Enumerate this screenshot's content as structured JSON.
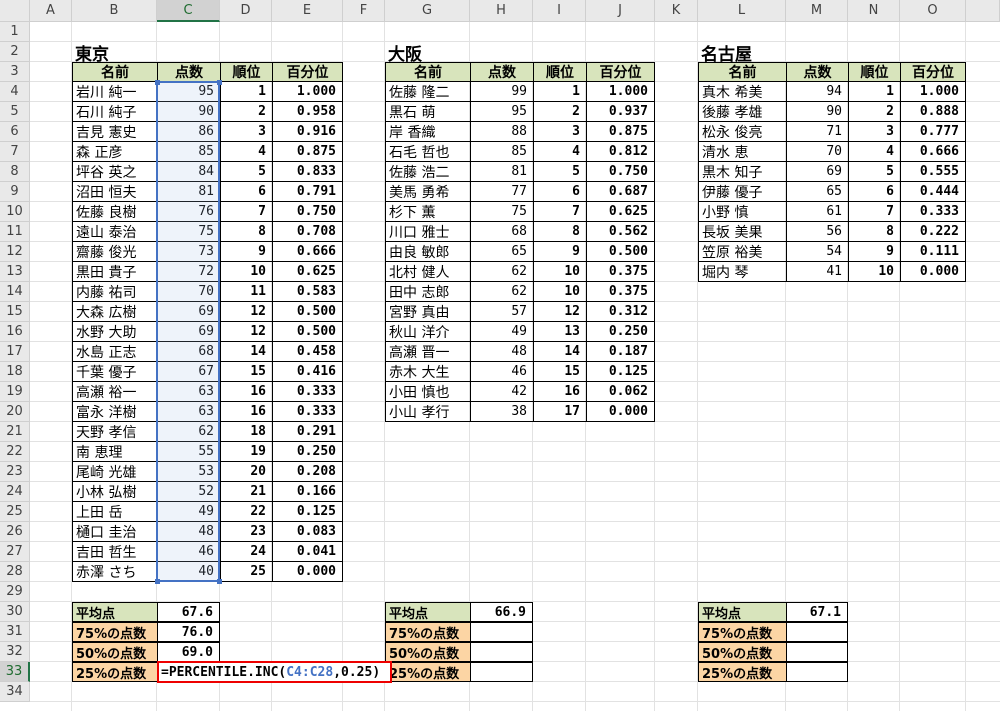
{
  "columns": [
    "A",
    "B",
    "C",
    "D",
    "E",
    "F",
    "G",
    "H",
    "I",
    "J",
    "K",
    "L",
    "M",
    "N",
    "O"
  ],
  "rows": [
    "1",
    "2",
    "3",
    "4",
    "5",
    "6",
    "7",
    "8",
    "9",
    "10",
    "11",
    "12",
    "13",
    "14",
    "15",
    "16",
    "17",
    "18",
    "19",
    "20",
    "21",
    "22",
    "23",
    "24",
    "25",
    "26",
    "27",
    "28",
    "29",
    "30",
    "31",
    "32",
    "33",
    "34"
  ],
  "active_column": "C",
  "active_row": "33",
  "tables": [
    {
      "id": "tokyo",
      "title": "東京",
      "headers": [
        "名前",
        "点数",
        "順位",
        "百分位"
      ],
      "rows": [
        [
          "岩川 純一",
          "95",
          "1",
          "1.000"
        ],
        [
          "石川 純子",
          "90",
          "2",
          "0.958"
        ],
        [
          "吉見 憲史",
          "86",
          "3",
          "0.916"
        ],
        [
          "森 正彦",
          "85",
          "4",
          "0.875"
        ],
        [
          "坪谷 英之",
          "84",
          "5",
          "0.833"
        ],
        [
          "沼田 恒夫",
          "81",
          "6",
          "0.791"
        ],
        [
          "佐藤 良樹",
          "76",
          "7",
          "0.750"
        ],
        [
          "遠山 泰治",
          "75",
          "8",
          "0.708"
        ],
        [
          "齋藤 俊光",
          "73",
          "9",
          "0.666"
        ],
        [
          "黒田 貴子",
          "72",
          "10",
          "0.625"
        ],
        [
          "内藤 祐司",
          "70",
          "11",
          "0.583"
        ],
        [
          "大森 広樹",
          "69",
          "12",
          "0.500"
        ],
        [
          "水野 大助",
          "69",
          "12",
          "0.500"
        ],
        [
          "水島 正志",
          "68",
          "14",
          "0.458"
        ],
        [
          "千葉 優子",
          "67",
          "15",
          "0.416"
        ],
        [
          "高瀬 裕一",
          "63",
          "16",
          "0.333"
        ],
        [
          "富永 洋樹",
          "63",
          "16",
          "0.333"
        ],
        [
          "天野 孝信",
          "62",
          "18",
          "0.291"
        ],
        [
          "南 恵理",
          "55",
          "19",
          "0.250"
        ],
        [
          "尾崎 光雄",
          "53",
          "20",
          "0.208"
        ],
        [
          "小林 弘樹",
          "52",
          "21",
          "0.166"
        ],
        [
          "上田 岳",
          "49",
          "22",
          "0.125"
        ],
        [
          "樋口 圭治",
          "48",
          "23",
          "0.083"
        ],
        [
          "吉田 哲生",
          "46",
          "24",
          "0.041"
        ],
        [
          "赤澤 さち",
          "40",
          "25",
          "0.000"
        ]
      ]
    },
    {
      "id": "osaka",
      "title": "大阪",
      "headers": [
        "名前",
        "点数",
        "順位",
        "百分位"
      ],
      "rows": [
        [
          "佐藤 隆二",
          "99",
          "1",
          "1.000"
        ],
        [
          "黒石 萌",
          "95",
          "2",
          "0.937"
        ],
        [
          "岸 香織",
          "88",
          "3",
          "0.875"
        ],
        [
          "石毛 哲也",
          "85",
          "4",
          "0.812"
        ],
        [
          "佐藤 浩二",
          "81",
          "5",
          "0.750"
        ],
        [
          "美馬 勇希",
          "77",
          "6",
          "0.687"
        ],
        [
          "杉下 薫",
          "75",
          "7",
          "0.625"
        ],
        [
          "川口 雅士",
          "68",
          "8",
          "0.562"
        ],
        [
          "由良 敏郎",
          "65",
          "9",
          "0.500"
        ],
        [
          "北村 健人",
          "62",
          "10",
          "0.375"
        ],
        [
          "田中 志郎",
          "62",
          "10",
          "0.375"
        ],
        [
          "宮野 真由",
          "57",
          "12",
          "0.312"
        ],
        [
          "秋山 洋介",
          "49",
          "13",
          "0.250"
        ],
        [
          "高瀬 晋一",
          "48",
          "14",
          "0.187"
        ],
        [
          "赤木 大生",
          "46",
          "15",
          "0.125"
        ],
        [
          "小田 慎也",
          "42",
          "16",
          "0.062"
        ],
        [
          "小山 孝行",
          "38",
          "17",
          "0.000"
        ]
      ]
    },
    {
      "id": "nagoya",
      "title": "名古屋",
      "headers": [
        "名前",
        "点数",
        "順位",
        "百分位"
      ],
      "rows": [
        [
          "真木 希美",
          "94",
          "1",
          "1.000"
        ],
        [
          "後藤 孝雄",
          "90",
          "2",
          "0.888"
        ],
        [
          "松永 俊亮",
          "71",
          "3",
          "0.777"
        ],
        [
          "清水 恵",
          "70",
          "4",
          "0.666"
        ],
        [
          "黒木 知子",
          "69",
          "5",
          "0.555"
        ],
        [
          "伊藤 優子",
          "65",
          "6",
          "0.444"
        ],
        [
          "小野 慎",
          "61",
          "7",
          "0.333"
        ],
        [
          "長坂 美果",
          "56",
          "8",
          "0.222"
        ],
        [
          "笠原 裕美",
          "54",
          "9",
          "0.111"
        ],
        [
          "堀内 琴",
          "41",
          "10",
          "0.000"
        ]
      ]
    }
  ],
  "summaries": [
    {
      "labels": [
        "平均点",
        "75%の点数",
        "50%の点数",
        "25%の点数"
      ],
      "values": [
        "67.6",
        "76.0",
        "69.0",
        ""
      ]
    },
    {
      "labels": [
        "平均点",
        "75%の点数",
        "50%の点数",
        "25%の点数"
      ],
      "values": [
        "66.9",
        "",
        "",
        ""
      ]
    },
    {
      "labels": [
        "平均点",
        "75%の点数",
        "50%の点数",
        "25%の点数"
      ],
      "values": [
        "67.1",
        "",
        "",
        ""
      ]
    }
  ],
  "formula": {
    "prefix": "=PERCENTILE.INC(",
    "ref": "C4:C28",
    "suffix": ",0.25)"
  },
  "colors": {
    "header_fill": "#d8e4bc",
    "orange_fill": "#fcd5a4",
    "selection": "#4472c4",
    "formula_border": "#e00000"
  }
}
